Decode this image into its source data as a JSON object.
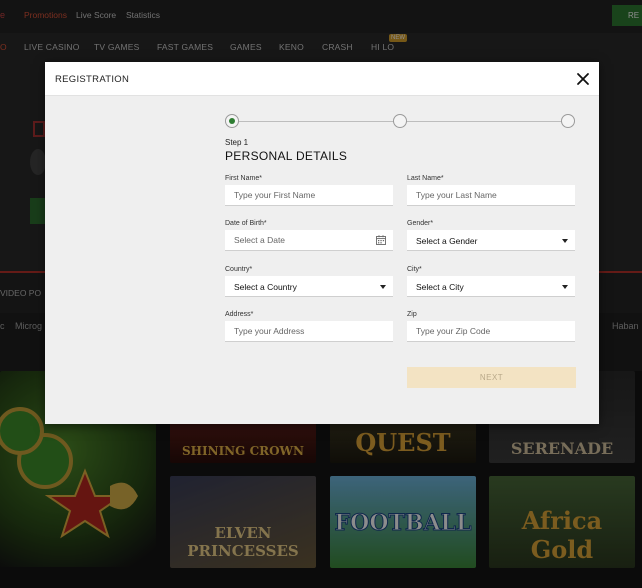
{
  "topbar": {
    "links": [
      {
        "label": "Promotions",
        "active": true
      },
      {
        "label": "Live Score",
        "active": false
      },
      {
        "label": "Statistics",
        "active": false
      }
    ],
    "right_button": "RE"
  },
  "nav": {
    "items": [
      "LIVE CASINO",
      "TV GAMES",
      "FAST GAMES",
      "GAMES",
      "KENO",
      "CRASH",
      "HI LO"
    ],
    "new_badge": "NEW"
  },
  "tabs": {
    "video_poker": "VIDEO PO"
  },
  "providers": {
    "left": "c",
    "micro": "Microg",
    "right": "Haban"
  },
  "games": [
    {
      "title": "SHINING CROWN"
    },
    {
      "title": "QUEST"
    },
    {
      "title": "SERENADE"
    },
    {
      "title": "ELVEN PRINCESSES"
    },
    {
      "title": "FOOTBALL"
    },
    {
      "title": "Africa Gold"
    }
  ],
  "modal": {
    "title": "REGISTRATION",
    "step": {
      "label": "Step 1",
      "title": "PERSONAL DETAILS",
      "current": 1,
      "total": 3
    },
    "fields": {
      "first_name": {
        "label": "First Name*",
        "placeholder": "Type your First Name",
        "value": ""
      },
      "last_name": {
        "label": "Last Name*",
        "placeholder": "Type your Last Name",
        "value": ""
      },
      "dob": {
        "label": "Date of Birth*",
        "placeholder": "Select a Date",
        "value": ""
      },
      "gender": {
        "label": "Gender*",
        "value": "Select a Gender"
      },
      "country": {
        "label": "Country*",
        "value": "Select a Country"
      },
      "city": {
        "label": "City*",
        "value": "Select a City"
      },
      "address": {
        "label": "Address*",
        "placeholder": "Type your Address",
        "value": ""
      },
      "zip": {
        "label": "Zip",
        "placeholder": "Type your Zip Code",
        "value": ""
      }
    },
    "next_label": "NEXT"
  },
  "colors": {
    "accent_green": "#2e7d32",
    "promo_red": "#e0553a",
    "next_disabled_bg": "#f3e3c3"
  }
}
